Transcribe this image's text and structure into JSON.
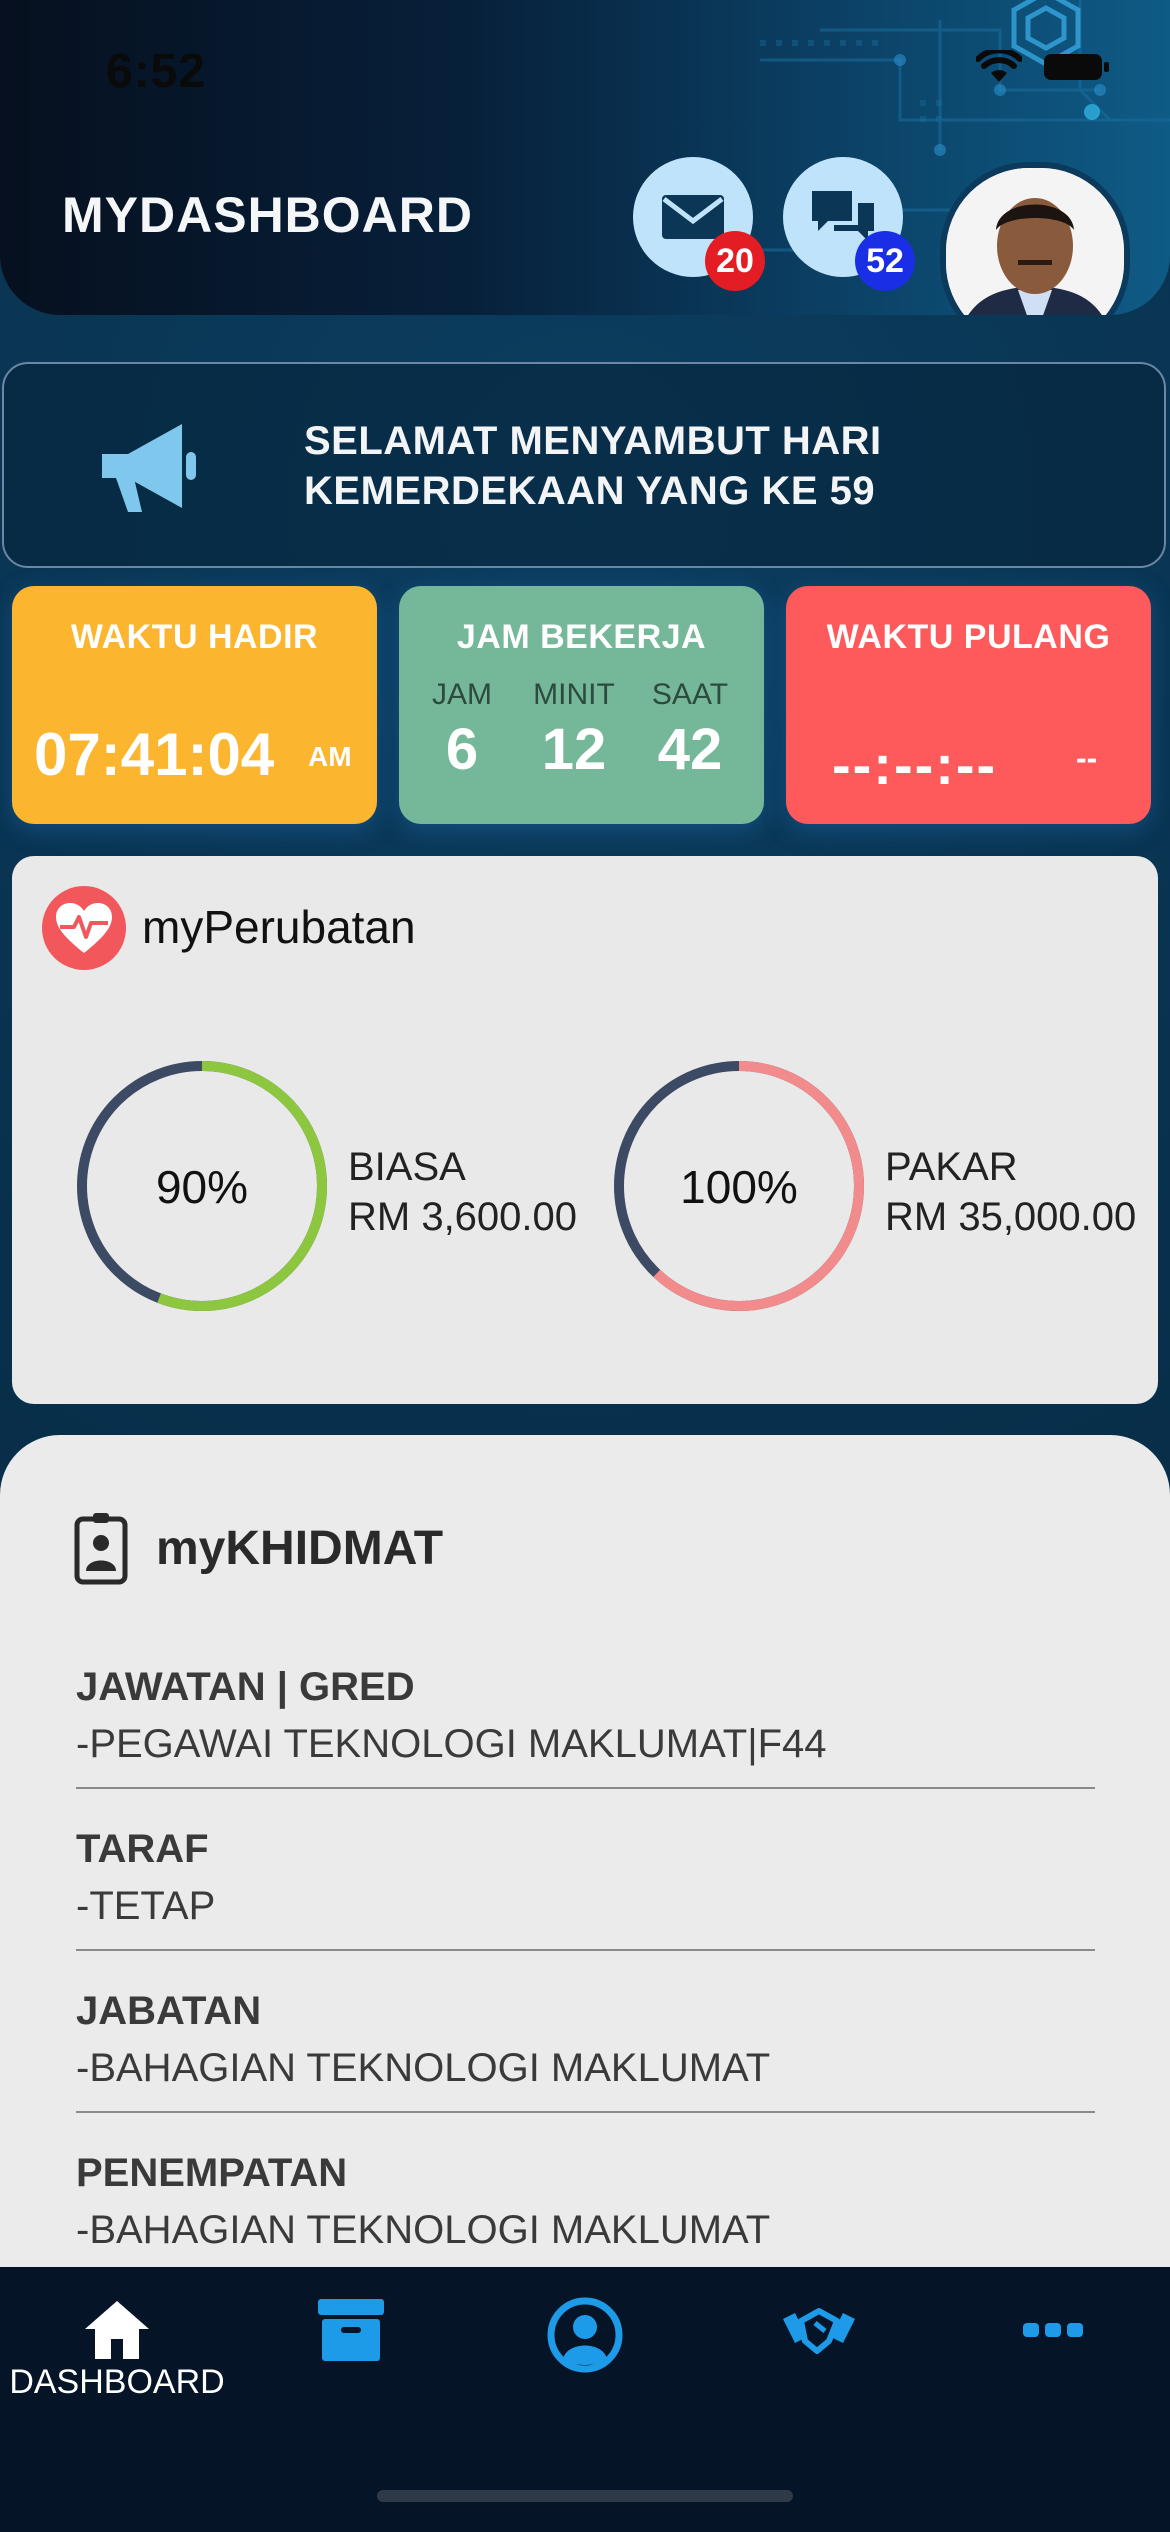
{
  "status_bar": {
    "time": "6:52",
    "icons": [
      "wifi-icon",
      "battery-icon"
    ]
  },
  "header": {
    "title": "MYDASHBOARD",
    "mail_badge": "20",
    "chat_badge": "52",
    "icons": [
      "mail-icon",
      "chat-bubbles-icon",
      "avatar"
    ]
  },
  "announcement": {
    "icon": "megaphone-icon",
    "line1": "SELAMAT MENYAMBUT HARI",
    "line2": "KEMERDEKAAN YANG KE 59"
  },
  "time_cards": {
    "waktu_hadir": {
      "title": "WAKTU HADIR",
      "time": "07:41:04",
      "ampm": "AM",
      "color": "#fcb52f"
    },
    "jam_bekerja": {
      "title": "JAM BEKERJA",
      "units": [
        "JAM",
        "MINIT",
        "SAAT"
      ],
      "values": [
        "6",
        "12",
        "42"
      ],
      "color": "#75b899"
    },
    "waktu_pulang": {
      "title": "WAKTU PULANG",
      "time": "--:--:--",
      "ampm": "--",
      "color": "#fe5a5b"
    }
  },
  "perubatan": {
    "title": "myPerubatan",
    "icon": "heart-pulse-icon",
    "items": [
      {
        "percent": "90%",
        "percent_value": 0.9,
        "label": "BIASA",
        "amount": "RM 3,600.00",
        "color": "#8dc63f"
      },
      {
        "percent": "100%",
        "percent_value": 1.0,
        "label": "PAKAR",
        "amount": "RM 35,000.00",
        "color": "#f28b8b"
      }
    ]
  },
  "khidmat": {
    "title": "myKHIDMAT",
    "icon": "id-badge-icon",
    "items": [
      {
        "label": "JAWATAN | GRED",
        "value": "-PEGAWAI TEKNOLOGI MAKLUMAT|F44"
      },
      {
        "label": "TARAF",
        "value": "-TETAP"
      },
      {
        "label": "JABATAN",
        "value": "-BAHAGIAN TEKNOLOGI MAKLUMAT"
      },
      {
        "label": "PENEMPATAN",
        "value": "-BAHAGIAN TEKNOLOGI MAKLUMAT"
      }
    ]
  },
  "tabbar": {
    "items": [
      {
        "label": "DASHBOARD",
        "icon": "home-icon"
      },
      {
        "label": "",
        "icon": "archive-icon"
      },
      {
        "label": "",
        "icon": "user-circle-icon"
      },
      {
        "label": "",
        "icon": "handshake-icon"
      },
      {
        "label": "",
        "icon": "more-icon"
      }
    ],
    "active_color": "#ffffff",
    "inactive_color": "#1e9be8"
  }
}
